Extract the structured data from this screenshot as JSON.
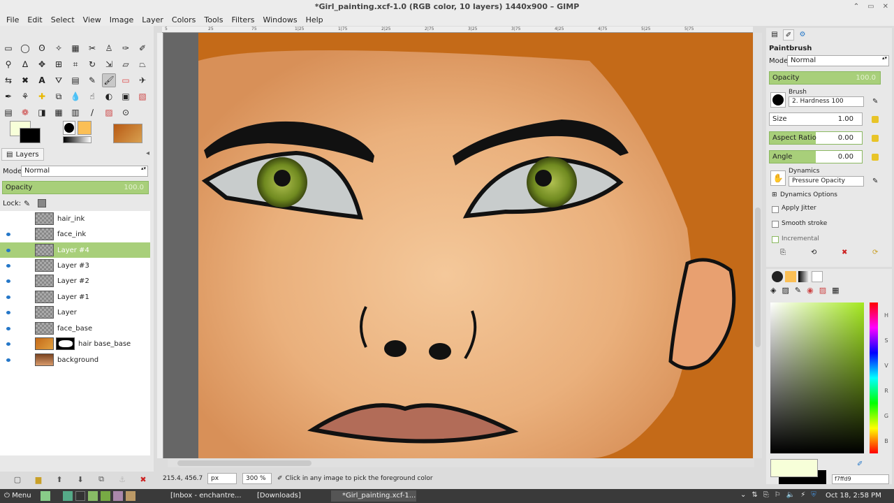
{
  "window": {
    "title": "*Girl_painting.xcf-1.0 (RGB color, 10 layers) 1440x900 – GIMP",
    "controls": [
      "⌃",
      "▭",
      "✕"
    ]
  },
  "menubar": [
    "File",
    "Edit",
    "Select",
    "View",
    "Image",
    "Layer",
    "Colors",
    "Tools",
    "Filters",
    "Windows",
    "Help"
  ],
  "layers_panel": {
    "tab_label": "Layers",
    "mode_label": "Mode:",
    "mode_value": "Normal",
    "opacity_label": "Opacity",
    "opacity_value": "100.0",
    "lock_label": "Lock:",
    "layers": [
      {
        "name": "hair_ink",
        "visible": false,
        "selected": false
      },
      {
        "name": "face_ink",
        "visible": true,
        "selected": false
      },
      {
        "name": "Layer #4",
        "visible": true,
        "selected": true
      },
      {
        "name": "Layer #3",
        "visible": true,
        "selected": false
      },
      {
        "name": "Layer #2",
        "visible": true,
        "selected": false
      },
      {
        "name": "Layer #1",
        "visible": true,
        "selected": false
      },
      {
        "name": "Layer",
        "visible": true,
        "selected": false
      },
      {
        "name": "face_base",
        "visible": true,
        "selected": false
      },
      {
        "name": "hair base_base",
        "visible": true,
        "selected": false
      },
      {
        "name": "background",
        "visible": true,
        "selected": false
      }
    ]
  },
  "status": {
    "coords": "215.4, 456.7",
    "unit": "px",
    "zoom": "300 %",
    "message": "Click in any image to pick the foreground color"
  },
  "tool_options": {
    "title": "Paintbrush",
    "mode_label": "Mode:",
    "mode_value": "Normal",
    "opacity_label": "Opacity",
    "opacity_value": "100.0",
    "brush_label": "Brush",
    "brush_value": "2. Hardness 100",
    "size_label": "Size",
    "size_value": "1.00",
    "aspect_label": "Aspect Ratio",
    "aspect_value": "0.00",
    "angle_label": "Angle",
    "angle_value": "0.00",
    "dynamics_label": "Dynamics",
    "dynamics_value": "Pressure Opacity",
    "dynamics_options": "Dynamics Options",
    "apply_jitter": "Apply Jitter",
    "smooth_stroke": "Smooth stroke",
    "incremental": "Incremental"
  },
  "palette": {
    "hex_value": "f7ffd9",
    "hsv_labels": [
      "H",
      "S",
      "V",
      "R",
      "G",
      "B"
    ]
  },
  "colors": {
    "fg": "#f7ffd9",
    "bg": "#000000",
    "selection": "#a8cf7a"
  },
  "taskbar": {
    "menu": "Menu",
    "tasks": [
      "[Inbox - enchantre...",
      "[Downloads]",
      "*Girl_painting.xcf-1..."
    ],
    "clock": "Oct 18,  2:58 PM"
  },
  "ruler_labels": [
    "5",
    "25",
    "75",
    "1|25",
    "1|75",
    "2|25",
    "2|75",
    "3|25",
    "3|75",
    "4|25",
    "4|75",
    "5|25",
    "5|75"
  ]
}
